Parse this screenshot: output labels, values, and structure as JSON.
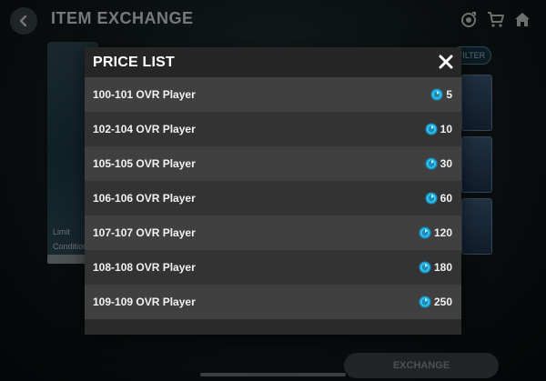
{
  "header": {
    "title": "ITEM EXCHANGE",
    "icons": [
      "back-arrow-icon",
      "target-icon",
      "cart-icon",
      "home-icon"
    ]
  },
  "background": {
    "limit_label": "Limit",
    "condition_label": "Condition",
    "filter_label": "FILTER",
    "exchange_label": "EXCHANGE"
  },
  "modal": {
    "title": "PRICE LIST",
    "close_icon": "close-icon",
    "rows": [
      {
        "label": "100-101 OVR Player",
        "price": "5"
      },
      {
        "label": "102-104 OVR Player",
        "price": "10"
      },
      {
        "label": "105-105 OVR Player",
        "price": "30"
      },
      {
        "label": "106-106 OVR Player",
        "price": "60"
      },
      {
        "label": "107-107 OVR Player",
        "price": "120"
      },
      {
        "label": "108-108 OVR Player",
        "price": "180"
      },
      {
        "label": "109-109 OVR Player",
        "price": "250"
      }
    ]
  },
  "colors": {
    "modal_bg": "#2b2b2b",
    "row_light": "#404040",
    "row_dark": "#333333",
    "coin_accent": "#2ec3f0"
  }
}
